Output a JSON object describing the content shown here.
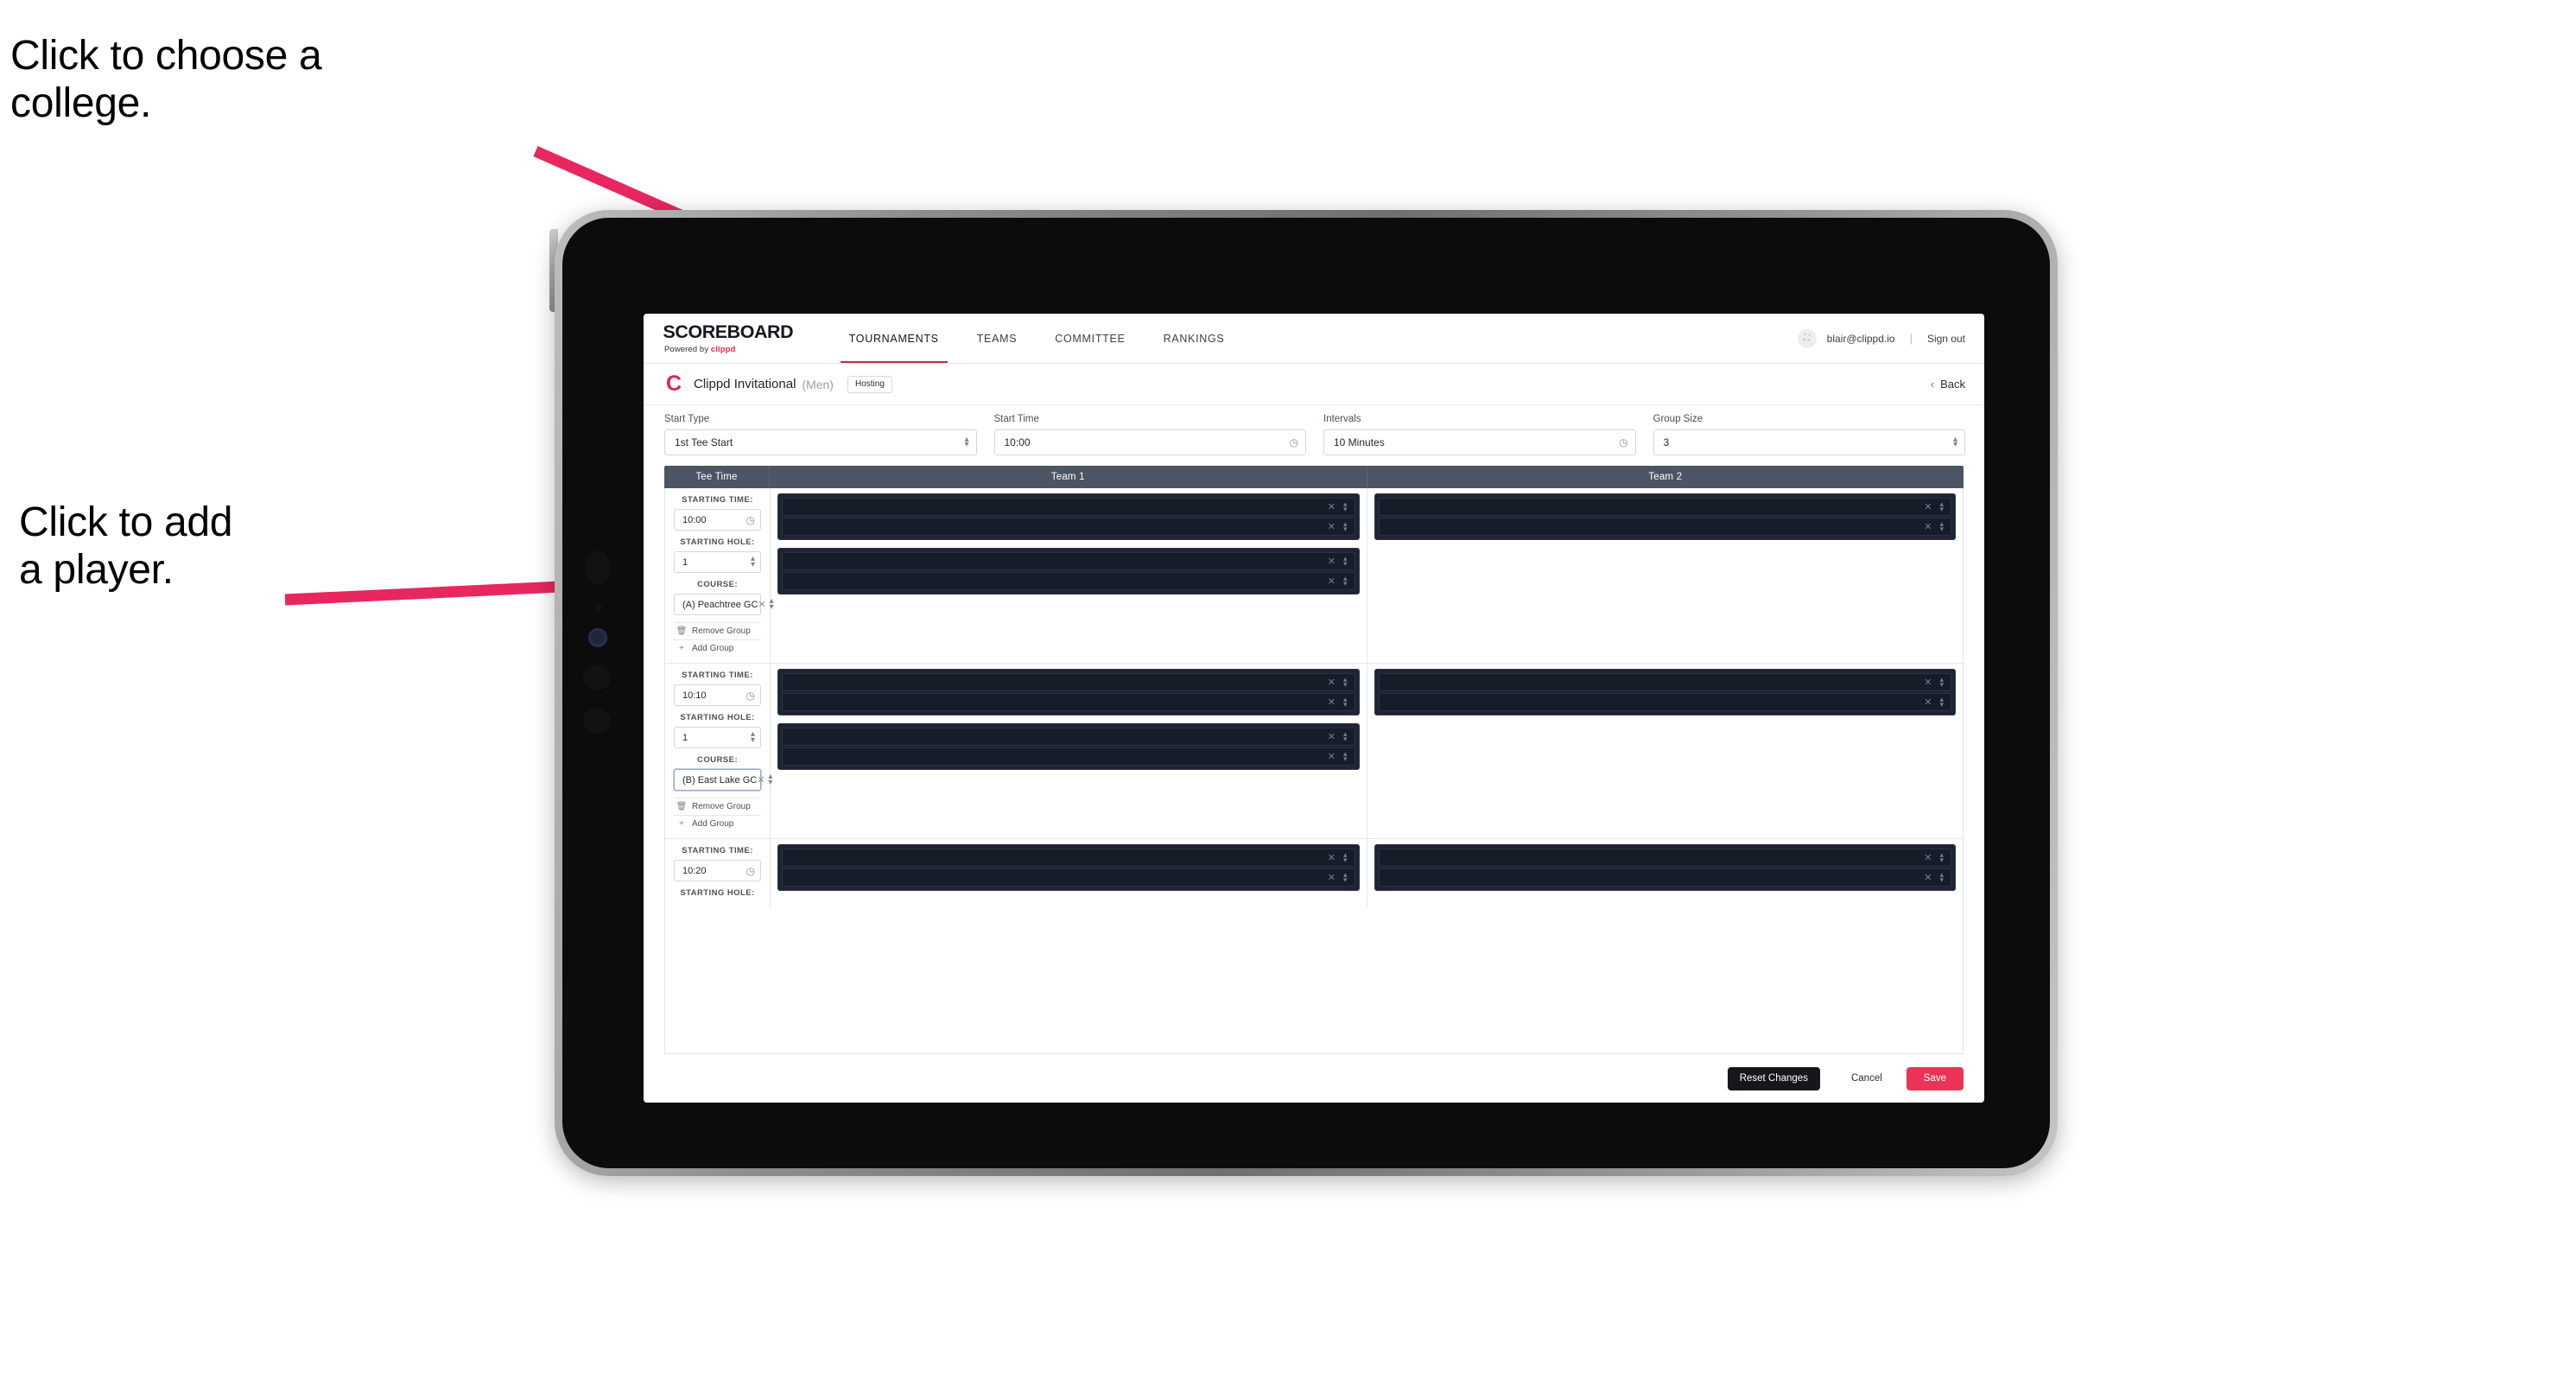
{
  "annotations": {
    "choose_college": "Click to choose a\ncollege.",
    "add_player": "Click to add\na player."
  },
  "colors": {
    "accent_pink": "#ea3356",
    "brand_red": "#d62a52",
    "table_header": "#4d5565",
    "panel_dark": "#1e2433",
    "slot_dark": "#171c29"
  },
  "app": {
    "brand": {
      "wordmark": "SCOREBOARD",
      "powered_prefix": "Powered by ",
      "powered_name": "clippd"
    },
    "nav": [
      {
        "label": "TOURNAMENTS",
        "active": true
      },
      {
        "label": "TEAMS",
        "active": false
      },
      {
        "label": "COMMITTEE",
        "active": false
      },
      {
        "label": "RANKINGS",
        "active": false
      }
    ],
    "account": {
      "avatar_glyph": "⛶",
      "email": "blair@clippd.io",
      "separator": "|",
      "sign_out": "Sign out"
    },
    "tournament": {
      "logo_letter": "C",
      "name": "Clippd Invitational",
      "gender": "(Men)",
      "status_badge": "Hosting",
      "back_label": "Back",
      "back_chevron": "‹"
    },
    "controls": [
      {
        "label": "Start Type",
        "value": "1st Tee Start",
        "icon": "stepper-icon"
      },
      {
        "label": "Start Time",
        "value": "10:00",
        "icon": "clock-icon"
      },
      {
        "label": "Intervals",
        "value": "10 Minutes",
        "icon": "clock-icon"
      },
      {
        "label": "Group Size",
        "value": "3",
        "icon": "stepper-icon"
      }
    ],
    "table": {
      "columns": [
        "Tee Time",
        "Team 1",
        "Team 2"
      ],
      "field_labels": {
        "starting_time": "STARTING TIME:",
        "starting_hole": "STARTING HOLE:",
        "course": "COURSE:"
      },
      "group_actions": {
        "remove": "Remove Group",
        "remove_icon": "trash-icon",
        "add": "Add Group",
        "add_icon": "plus-icon"
      },
      "rows": [
        {
          "starting_time": "10:00",
          "starting_hole": "1",
          "course": "(A) Peachtree GC",
          "course_focused": false,
          "team1_groups": [
            {
              "slots": [
                "",
                ""
              ]
            },
            {
              "slots": [
                "",
                ""
              ]
            }
          ],
          "team2_groups": [
            {
              "slots": [
                "",
                ""
              ]
            }
          ]
        },
        {
          "starting_time": "10:10",
          "starting_hole": "1",
          "course": "(B) East Lake GC",
          "course_focused": true,
          "team1_groups": [
            {
              "slots": [
                "",
                ""
              ]
            },
            {
              "slots": [
                "",
                ""
              ]
            }
          ],
          "team2_groups": [
            {
              "slots": [
                "",
                ""
              ]
            }
          ]
        },
        {
          "starting_time": "10:20",
          "starting_hole": "",
          "course": "",
          "course_focused": false,
          "team1_groups": [
            {
              "slots": [
                "",
                ""
              ]
            }
          ],
          "team2_groups": [
            {
              "slots": [
                "",
                ""
              ]
            }
          ]
        }
      ]
    },
    "footer": {
      "reset": "Reset Changes",
      "cancel": "Cancel",
      "save": "Save"
    }
  }
}
